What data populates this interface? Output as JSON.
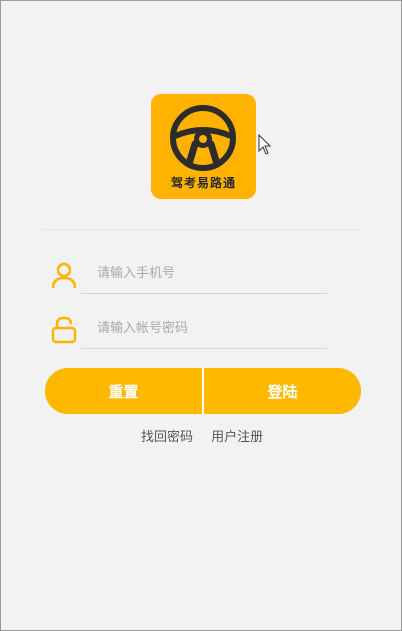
{
  "app": {
    "name": "驾考易路通",
    "accent_color": "#ffb800"
  },
  "logo": {
    "icon": "steering-wheel-icon",
    "text": "驾考易路通"
  },
  "form": {
    "phone": {
      "icon": "user-icon",
      "placeholder": "请输入手机号",
      "value": ""
    },
    "password": {
      "icon": "lock-icon",
      "placeholder": "请输入帐号密码",
      "value": ""
    }
  },
  "buttons": {
    "reset": "重置",
    "login": "登陆"
  },
  "links": {
    "forgot_password": "找回密码",
    "register": "用户注册"
  }
}
